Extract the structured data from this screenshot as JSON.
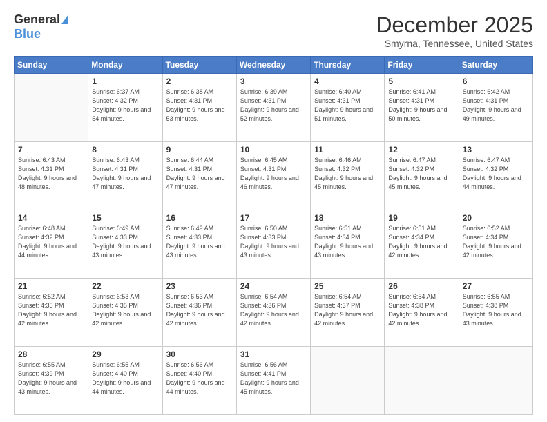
{
  "logo": {
    "general": "General",
    "blue": "Blue"
  },
  "header": {
    "title": "December 2025",
    "location": "Smyrna, Tennessee, United States"
  },
  "weekdays": [
    "Sunday",
    "Monday",
    "Tuesday",
    "Wednesday",
    "Thursday",
    "Friday",
    "Saturday"
  ],
  "weeks": [
    [
      {
        "day": "",
        "sunrise": "",
        "sunset": "",
        "daylight": ""
      },
      {
        "day": "1",
        "sunrise": "Sunrise: 6:37 AM",
        "sunset": "Sunset: 4:32 PM",
        "daylight": "Daylight: 9 hours and 54 minutes."
      },
      {
        "day": "2",
        "sunrise": "Sunrise: 6:38 AM",
        "sunset": "Sunset: 4:31 PM",
        "daylight": "Daylight: 9 hours and 53 minutes."
      },
      {
        "day": "3",
        "sunrise": "Sunrise: 6:39 AM",
        "sunset": "Sunset: 4:31 PM",
        "daylight": "Daylight: 9 hours and 52 minutes."
      },
      {
        "day": "4",
        "sunrise": "Sunrise: 6:40 AM",
        "sunset": "Sunset: 4:31 PM",
        "daylight": "Daylight: 9 hours and 51 minutes."
      },
      {
        "day": "5",
        "sunrise": "Sunrise: 6:41 AM",
        "sunset": "Sunset: 4:31 PM",
        "daylight": "Daylight: 9 hours and 50 minutes."
      },
      {
        "day": "6",
        "sunrise": "Sunrise: 6:42 AM",
        "sunset": "Sunset: 4:31 PM",
        "daylight": "Daylight: 9 hours and 49 minutes."
      }
    ],
    [
      {
        "day": "7",
        "sunrise": "Sunrise: 6:43 AM",
        "sunset": "Sunset: 4:31 PM",
        "daylight": "Daylight: 9 hours and 48 minutes."
      },
      {
        "day": "8",
        "sunrise": "Sunrise: 6:43 AM",
        "sunset": "Sunset: 4:31 PM",
        "daylight": "Daylight: 9 hours and 47 minutes."
      },
      {
        "day": "9",
        "sunrise": "Sunrise: 6:44 AM",
        "sunset": "Sunset: 4:31 PM",
        "daylight": "Daylight: 9 hours and 47 minutes."
      },
      {
        "day": "10",
        "sunrise": "Sunrise: 6:45 AM",
        "sunset": "Sunset: 4:31 PM",
        "daylight": "Daylight: 9 hours and 46 minutes."
      },
      {
        "day": "11",
        "sunrise": "Sunrise: 6:46 AM",
        "sunset": "Sunset: 4:32 PM",
        "daylight": "Daylight: 9 hours and 45 minutes."
      },
      {
        "day": "12",
        "sunrise": "Sunrise: 6:47 AM",
        "sunset": "Sunset: 4:32 PM",
        "daylight": "Daylight: 9 hours and 45 minutes."
      },
      {
        "day": "13",
        "sunrise": "Sunrise: 6:47 AM",
        "sunset": "Sunset: 4:32 PM",
        "daylight": "Daylight: 9 hours and 44 minutes."
      }
    ],
    [
      {
        "day": "14",
        "sunrise": "Sunrise: 6:48 AM",
        "sunset": "Sunset: 4:32 PM",
        "daylight": "Daylight: 9 hours and 44 minutes."
      },
      {
        "day": "15",
        "sunrise": "Sunrise: 6:49 AM",
        "sunset": "Sunset: 4:33 PM",
        "daylight": "Daylight: 9 hours and 43 minutes."
      },
      {
        "day": "16",
        "sunrise": "Sunrise: 6:49 AM",
        "sunset": "Sunset: 4:33 PM",
        "daylight": "Daylight: 9 hours and 43 minutes."
      },
      {
        "day": "17",
        "sunrise": "Sunrise: 6:50 AM",
        "sunset": "Sunset: 4:33 PM",
        "daylight": "Daylight: 9 hours and 43 minutes."
      },
      {
        "day": "18",
        "sunrise": "Sunrise: 6:51 AM",
        "sunset": "Sunset: 4:34 PM",
        "daylight": "Daylight: 9 hours and 43 minutes."
      },
      {
        "day": "19",
        "sunrise": "Sunrise: 6:51 AM",
        "sunset": "Sunset: 4:34 PM",
        "daylight": "Daylight: 9 hours and 42 minutes."
      },
      {
        "day": "20",
        "sunrise": "Sunrise: 6:52 AM",
        "sunset": "Sunset: 4:34 PM",
        "daylight": "Daylight: 9 hours and 42 minutes."
      }
    ],
    [
      {
        "day": "21",
        "sunrise": "Sunrise: 6:52 AM",
        "sunset": "Sunset: 4:35 PM",
        "daylight": "Daylight: 9 hours and 42 minutes."
      },
      {
        "day": "22",
        "sunrise": "Sunrise: 6:53 AM",
        "sunset": "Sunset: 4:35 PM",
        "daylight": "Daylight: 9 hours and 42 minutes."
      },
      {
        "day": "23",
        "sunrise": "Sunrise: 6:53 AM",
        "sunset": "Sunset: 4:36 PM",
        "daylight": "Daylight: 9 hours and 42 minutes."
      },
      {
        "day": "24",
        "sunrise": "Sunrise: 6:54 AM",
        "sunset": "Sunset: 4:36 PM",
        "daylight": "Daylight: 9 hours and 42 minutes."
      },
      {
        "day": "25",
        "sunrise": "Sunrise: 6:54 AM",
        "sunset": "Sunset: 4:37 PM",
        "daylight": "Daylight: 9 hours and 42 minutes."
      },
      {
        "day": "26",
        "sunrise": "Sunrise: 6:54 AM",
        "sunset": "Sunset: 4:38 PM",
        "daylight": "Daylight: 9 hours and 42 minutes."
      },
      {
        "day": "27",
        "sunrise": "Sunrise: 6:55 AM",
        "sunset": "Sunset: 4:38 PM",
        "daylight": "Daylight: 9 hours and 43 minutes."
      }
    ],
    [
      {
        "day": "28",
        "sunrise": "Sunrise: 6:55 AM",
        "sunset": "Sunset: 4:39 PM",
        "daylight": "Daylight: 9 hours and 43 minutes."
      },
      {
        "day": "29",
        "sunrise": "Sunrise: 6:55 AM",
        "sunset": "Sunset: 4:40 PM",
        "daylight": "Daylight: 9 hours and 44 minutes."
      },
      {
        "day": "30",
        "sunrise": "Sunrise: 6:56 AM",
        "sunset": "Sunset: 4:40 PM",
        "daylight": "Daylight: 9 hours and 44 minutes."
      },
      {
        "day": "31",
        "sunrise": "Sunrise: 6:56 AM",
        "sunset": "Sunset: 4:41 PM",
        "daylight": "Daylight: 9 hours and 45 minutes."
      },
      {
        "day": "",
        "sunrise": "",
        "sunset": "",
        "daylight": ""
      },
      {
        "day": "",
        "sunrise": "",
        "sunset": "",
        "daylight": ""
      },
      {
        "day": "",
        "sunrise": "",
        "sunset": "",
        "daylight": ""
      }
    ]
  ]
}
